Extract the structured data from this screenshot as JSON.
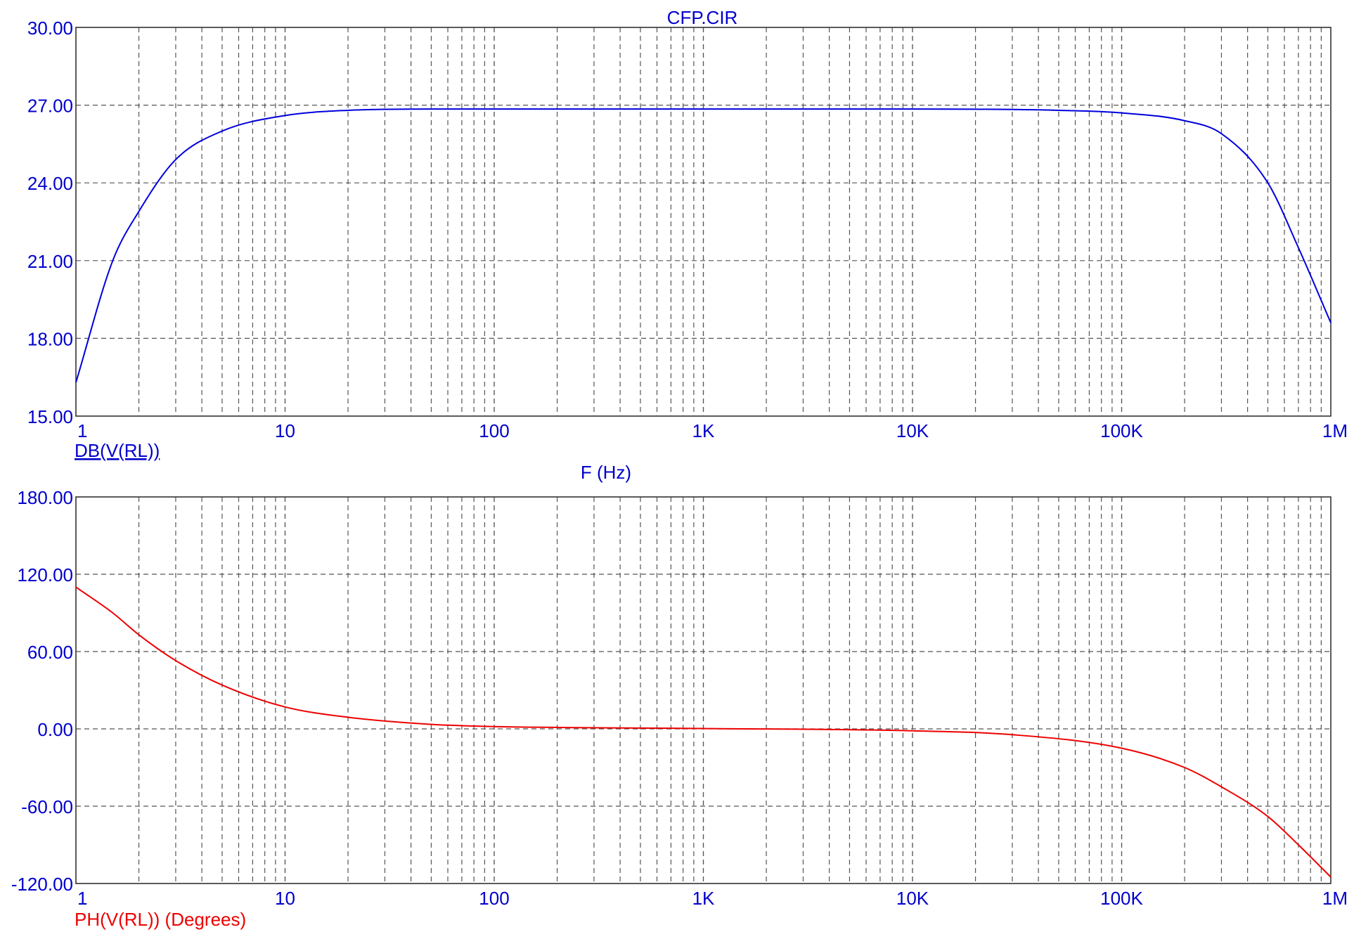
{
  "title": "CFP.CIR",
  "colors": {
    "magnitude": "#0000dd",
    "phase": "#ee0000",
    "axis_text": "#0000cc",
    "grid": "#555555",
    "frame": "#333333"
  },
  "chart_data": [
    {
      "type": "line",
      "title": "CFP.CIR",
      "xlabel": "F (Hz)",
      "x_scale": "log",
      "xlim": [
        1,
        1000000
      ],
      "x_ticks": [
        1,
        10,
        100,
        1000,
        10000,
        100000,
        1000000
      ],
      "x_tick_labels": [
        "1",
        "10",
        "100",
        "1K",
        "10K",
        "100K",
        "1M"
      ],
      "ylim": [
        15,
        30
      ],
      "y_ticks": [
        15,
        18,
        21,
        24,
        27,
        30
      ],
      "y_tick_labels": [
        "15.00",
        "18.00",
        "21.00",
        "24.00",
        "27.00",
        "30.00"
      ],
      "grid": true,
      "series": [
        {
          "name": "DB(V(RL))",
          "color": "#0000dd",
          "x": [
            1,
            1.5,
            2,
            3,
            5,
            10,
            20,
            50,
            100,
            1000,
            10000,
            50000,
            100000,
            200000,
            300000,
            500000,
            700000,
            1000000
          ],
          "y": [
            16.3,
            21.0,
            22.9,
            24.9,
            26.0,
            26.6,
            26.8,
            26.85,
            26.85,
            26.85,
            26.85,
            26.8,
            26.7,
            26.4,
            25.9,
            24.0,
            21.5,
            18.6
          ]
        }
      ]
    },
    {
      "type": "line",
      "xlabel": "F (Hz)",
      "x_scale": "log",
      "xlim": [
        1,
        1000000
      ],
      "x_ticks": [
        1,
        10,
        100,
        1000,
        10000,
        100000,
        1000000
      ],
      "x_tick_labels": [
        "1",
        "10",
        "100",
        "1K",
        "10K",
        "100K",
        "1M"
      ],
      "ylim": [
        -120,
        180
      ],
      "y_ticks": [
        -120,
        -60,
        0,
        60,
        120,
        180
      ],
      "y_tick_labels": [
        "-120.00",
        "-60.00",
        "0.00",
        "60.00",
        "120.00",
        "180.00"
      ],
      "grid": true,
      "series": [
        {
          "name": "PH(V(RL)) (Degrees)",
          "color": "#ee0000",
          "x": [
            1,
            1.5,
            2,
            3,
            5,
            10,
            20,
            50,
            100,
            1000,
            10000,
            30000,
            100000,
            200000,
            300000,
            500000,
            700000,
            1000000
          ],
          "y": [
            110,
            90,
            73,
            53,
            34,
            17,
            9,
            3.5,
            1.8,
            0.3,
            -1.5,
            -4.5,
            -15,
            -30,
            -45,
            -68,
            -90,
            -115
          ]
        }
      ]
    }
  ],
  "legend": {
    "top_series": "DB(V(RL))",
    "bottom_series": "PH(V(RL)) (Degrees)"
  }
}
